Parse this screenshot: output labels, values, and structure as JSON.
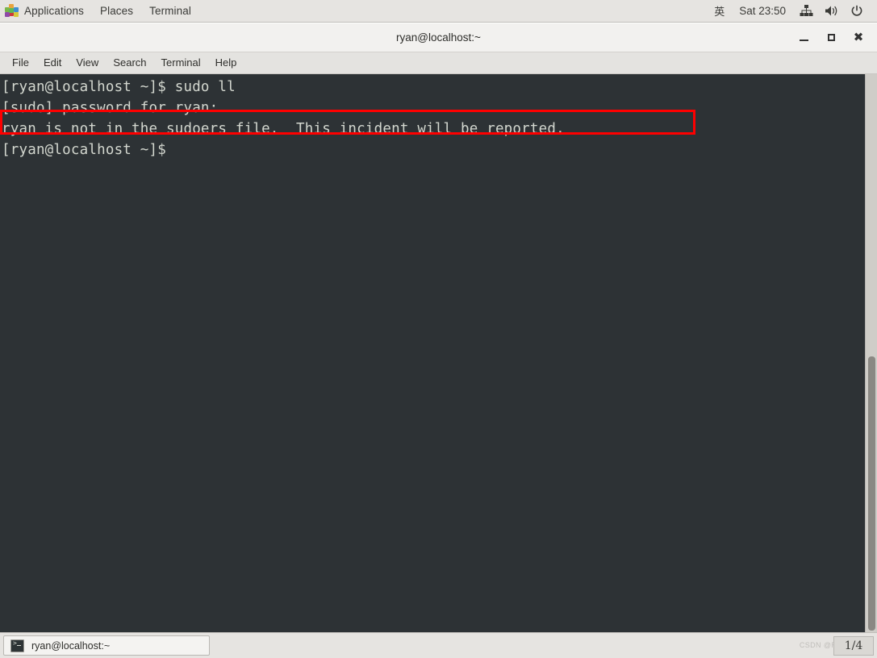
{
  "system_bar": {
    "apps_label": "Applications",
    "places_label": "Places",
    "terminal_label": "Terminal",
    "apps_icon": "applications-pinwheel-icon",
    "language_indicator": "英",
    "clock": "Sat 23:50",
    "tray": [
      {
        "icon": "network-icon",
        "name": "network-tray-icon"
      },
      {
        "icon": "volume-icon",
        "name": "volume-tray-icon"
      },
      {
        "icon": "power-icon",
        "name": "power-tray-icon"
      }
    ],
    "background": "#e6e4e1"
  },
  "window": {
    "title": "ryan@localhost:~",
    "controls": {
      "minimize": "minimize-button",
      "maximize": "maximize-button",
      "close": "close-button"
    }
  },
  "menubar": {
    "items": [
      {
        "label": "File"
      },
      {
        "label": "Edit"
      },
      {
        "label": "View"
      },
      {
        "label": "Search"
      },
      {
        "label": "Terminal"
      },
      {
        "label": "Help"
      }
    ]
  },
  "terminal": {
    "background": "#2d3235",
    "foreground": "#d3d7cf",
    "lines": [
      "[ryan@localhost ~]$ sudo ll",
      "[sudo] password for ryan:",
      "ryan is not in the sudoers file.  This incident will be reported.",
      "[ryan@localhost ~]$"
    ],
    "highlight": {
      "line_index": 2,
      "color": "#fe0000"
    }
  },
  "taskbar": {
    "task_button_label": "ryan@localhost:~",
    "task_button_icon": "terminal-icon",
    "workspace": "1/4",
    "watermark": "CSDN @Rrya"
  }
}
